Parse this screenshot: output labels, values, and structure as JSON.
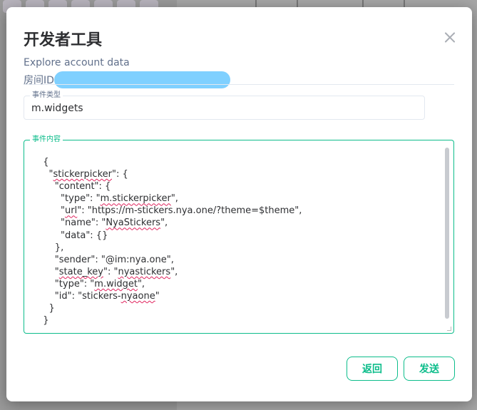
{
  "dialog": {
    "title": "开发者工具",
    "subtitle": "Explore account data",
    "room_id_label": "房间ID"
  },
  "event_type": {
    "legend": "事件类型",
    "value": "m.widgets"
  },
  "event_content": {
    "legend": "事件内容",
    "lines": [
      [
        {
          "t": "  {"
        }
      ],
      [
        {
          "t": "    \""
        },
        {
          "t": "stickerpicker",
          "sq": true
        },
        {
          "t": "\": {"
        }
      ],
      [
        {
          "t": "      \"content\": {"
        }
      ],
      [
        {
          "t": "        \"type\": \""
        },
        {
          "t": "m.stickerpicker",
          "sq": true
        },
        {
          "t": "\","
        }
      ],
      [
        {
          "t": "        \""
        },
        {
          "t": "url",
          "sq": true
        },
        {
          "t": "\": \"https://m-stickers.nya.one/?theme=$theme\","
        }
      ],
      [
        {
          "t": "        \"name\": \""
        },
        {
          "t": "NyaStickers",
          "sq": true
        },
        {
          "t": "\","
        }
      ],
      [
        {
          "t": "        \"data\": {}"
        }
      ],
      [
        {
          "t": "      },"
        }
      ],
      [
        {
          "t": "      \"sender\": \"@im:nya.one\","
        }
      ],
      [
        {
          "t": "      \""
        },
        {
          "t": "state_key",
          "sq": true
        },
        {
          "t": "\": \""
        },
        {
          "t": "nyastickers",
          "sq": true
        },
        {
          "t": "\","
        }
      ],
      [
        {
          "t": "      \"type\": \""
        },
        {
          "t": "m.widget",
          "sq": true
        },
        {
          "t": "\","
        }
      ],
      [
        {
          "t": "      \"id\": \"stickers-"
        },
        {
          "t": "nyaone",
          "sq": true
        },
        {
          "t": "\""
        }
      ],
      [
        {
          "t": "    }"
        }
      ],
      [
        {
          "t": "  }"
        }
      ]
    ]
  },
  "buttons": {
    "back_label": "返回",
    "send_label": "发送"
  },
  "icons": {
    "close": "close-icon"
  },
  "colors": {
    "accent": "#0dbd8b",
    "redaction": "#7fd0ff",
    "spellcheck": "#e0245e"
  }
}
